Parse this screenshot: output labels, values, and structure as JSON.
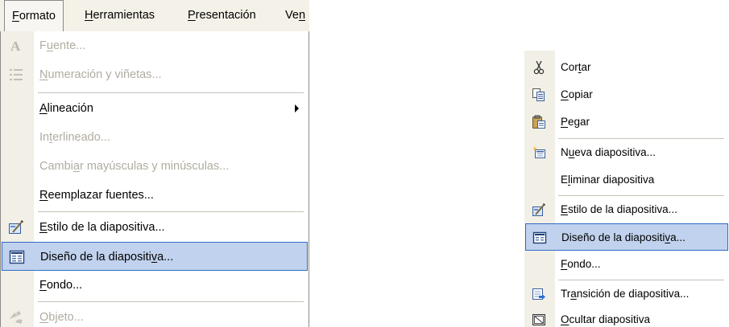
{
  "menubar": {
    "items": [
      {
        "pre": "",
        "u": "F",
        "post": "ormato"
      },
      {
        "pre": "",
        "u": "H",
        "post": "erramientas"
      },
      {
        "pre": "",
        "u": "P",
        "post": "resentación"
      },
      {
        "pre": "Ve",
        "u": "n",
        "post": ""
      }
    ]
  },
  "formato_menu": {
    "items": [
      {
        "pre": "F",
        "u": "u",
        "post": "ente...",
        "icon": "font-a-icon",
        "disabled": true
      },
      {
        "pre": "",
        "u": "N",
        "post": "umeración y viñetas...",
        "icon": "bullets-numbering-icon",
        "disabled": true
      },
      {
        "pre": "",
        "u": "A",
        "post": "lineación",
        "icon": "",
        "disabled": false,
        "submenu": true
      },
      {
        "pre": "In",
        "u": "t",
        "post": "erlineado...",
        "icon": "",
        "disabled": true
      },
      {
        "pre": "Cambi",
        "u": "a",
        "post": "r mayúsculas y minúsculas...",
        "icon": "",
        "disabled": true
      },
      {
        "pre": "",
        "u": "R",
        "post": "eemplazar fuentes...",
        "icon": "",
        "disabled": false
      },
      {
        "pre": "",
        "u": "E",
        "post": "stilo de la diapositiva...",
        "icon": "slide-design-icon",
        "disabled": false
      },
      {
        "pre": "Diseño de la diapositi",
        "u": "v",
        "post": "a...",
        "icon": "slide-layout-icon",
        "disabled": false,
        "highlighted": true
      },
      {
        "pre": "",
        "u": "F",
        "post": "ondo...",
        "icon": "",
        "disabled": false
      },
      {
        "pre": "",
        "u": "O",
        "post": "bjeto...",
        "icon": "format-object-icon",
        "disabled": true
      }
    ]
  },
  "context_menu": {
    "items": [
      {
        "pre": "Cor",
        "u": "t",
        "post": "ar",
        "icon": "scissors-icon"
      },
      {
        "pre": "",
        "u": "C",
        "post": "opiar",
        "icon": "copy-icon"
      },
      {
        "pre": "",
        "u": "P",
        "post": "egar",
        "icon": "paste-icon"
      },
      {
        "pre": "N",
        "u": "u",
        "post": "eva diapositiva...",
        "icon": "new-slide-icon"
      },
      {
        "pre": "E",
        "u": "l",
        "post": "iminar diapositiva",
        "icon": ""
      },
      {
        "pre": "",
        "u": "E",
        "post": "stilo de la diapositiva...",
        "icon": "slide-design-icon"
      },
      {
        "pre": "Diseño de la diapositi",
        "u": "v",
        "post": "a...",
        "icon": "slide-layout-icon",
        "highlighted": true
      },
      {
        "pre": "",
        "u": "F",
        "post": "ondo...",
        "icon": ""
      },
      {
        "pre": "Tr",
        "u": "a",
        "post": "nsición de diapositiva...",
        "icon": "slide-transition-icon"
      },
      {
        "pre": "",
        "u": "O",
        "post": "cultar diapositiva",
        "icon": "hide-slide-icon"
      }
    ]
  },
  "colors": {
    "menubar_bg": "#f4f1e8",
    "gutter_bg": "#f1efe6",
    "highlight_bg": "#c1d2ee",
    "highlight_border": "#316ac5",
    "disabled_text": "#b0aca0"
  }
}
